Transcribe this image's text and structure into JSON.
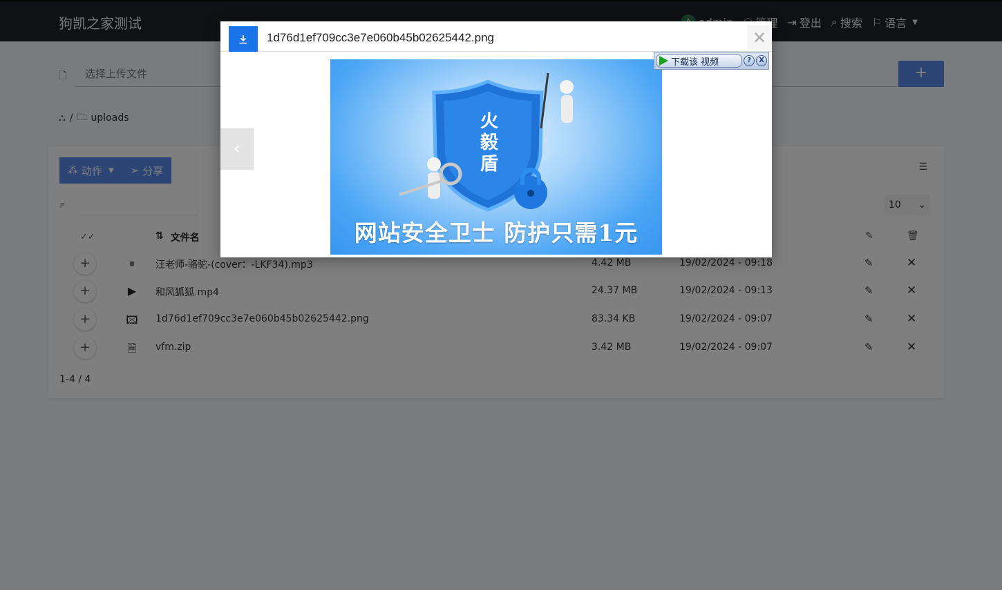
{
  "navbar": {
    "brand": "狗凯之家测试",
    "avatar_letter": "A",
    "user": "admin",
    "manage": "管理",
    "logout": "登出",
    "search": "搜索",
    "language": "语言"
  },
  "upload": {
    "placeholder": "选择上传文件",
    "button": "+"
  },
  "breadcrumb": {
    "folder": "uploads"
  },
  "toolbar": {
    "actions": "动作",
    "share": "分享",
    "page_size": "10"
  },
  "table": {
    "name_header": "文件名",
    "rows": [
      {
        "name": "汪老师-骆驼-(cover：-LKF34).mp3",
        "size": "4.42 MB",
        "date": "19/02/2024 - 09:18",
        "icon": "pause-circle-icon"
      },
      {
        "name": "和风狐狐.mp4",
        "size": "24.37 MB",
        "date": "19/02/2024 - 09:13",
        "icon": "video-icon"
      },
      {
        "name": "1d76d1ef709cc3e7e060b45b02625442.png",
        "size": "83.34 KB",
        "date": "19/02/2024 - 09:07",
        "icon": "image-icon"
      },
      {
        "name": "vfm.zip",
        "size": "3.42 MB",
        "date": "19/02/2024 - 09:07",
        "icon": "zip-file-icon"
      }
    ],
    "count": "1-4 / 4"
  },
  "modal": {
    "title": "1d76d1ef709cc3e7e060b45b02625442.png",
    "image": {
      "shield_text": "火 毅 盾",
      "banner": "网站安全卫士  防护只需1元"
    },
    "video_bar": {
      "download": "下载该 视频",
      "help": "?",
      "close": "X"
    }
  },
  "colors": {
    "primary": "#5b8ae8",
    "navbar": "#1f2328",
    "download_button": "#1a73e8"
  }
}
